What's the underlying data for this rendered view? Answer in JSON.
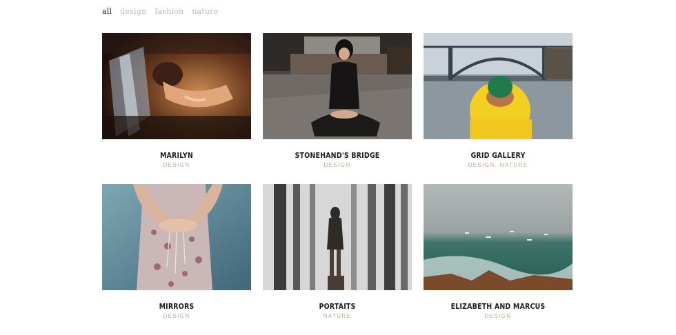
{
  "filters": [
    {
      "label": "all",
      "active": true
    },
    {
      "label": "design",
      "active": false
    },
    {
      "label": "fashion",
      "active": false
    },
    {
      "label": "nature",
      "active": false
    }
  ],
  "items": [
    {
      "title": "MARILYN",
      "category": "DESIGN"
    },
    {
      "title": "STONEHAND'S BRIDGE",
      "category": "DESIGN"
    },
    {
      "title": "GRID GALLERY",
      "category": "DESIGN, NATURE"
    },
    {
      "title": "MIRRORS",
      "category": "DESIGN"
    },
    {
      "title": "PORTAITS",
      "category": "NATURE"
    },
    {
      "title": "ELIZABETH AND MARCUS",
      "category": "DESIGN"
    }
  ],
  "colors": {
    "category_text": "#c4a58c",
    "filter_inactive": "#b9b9b9",
    "filter_active": "#222222"
  }
}
